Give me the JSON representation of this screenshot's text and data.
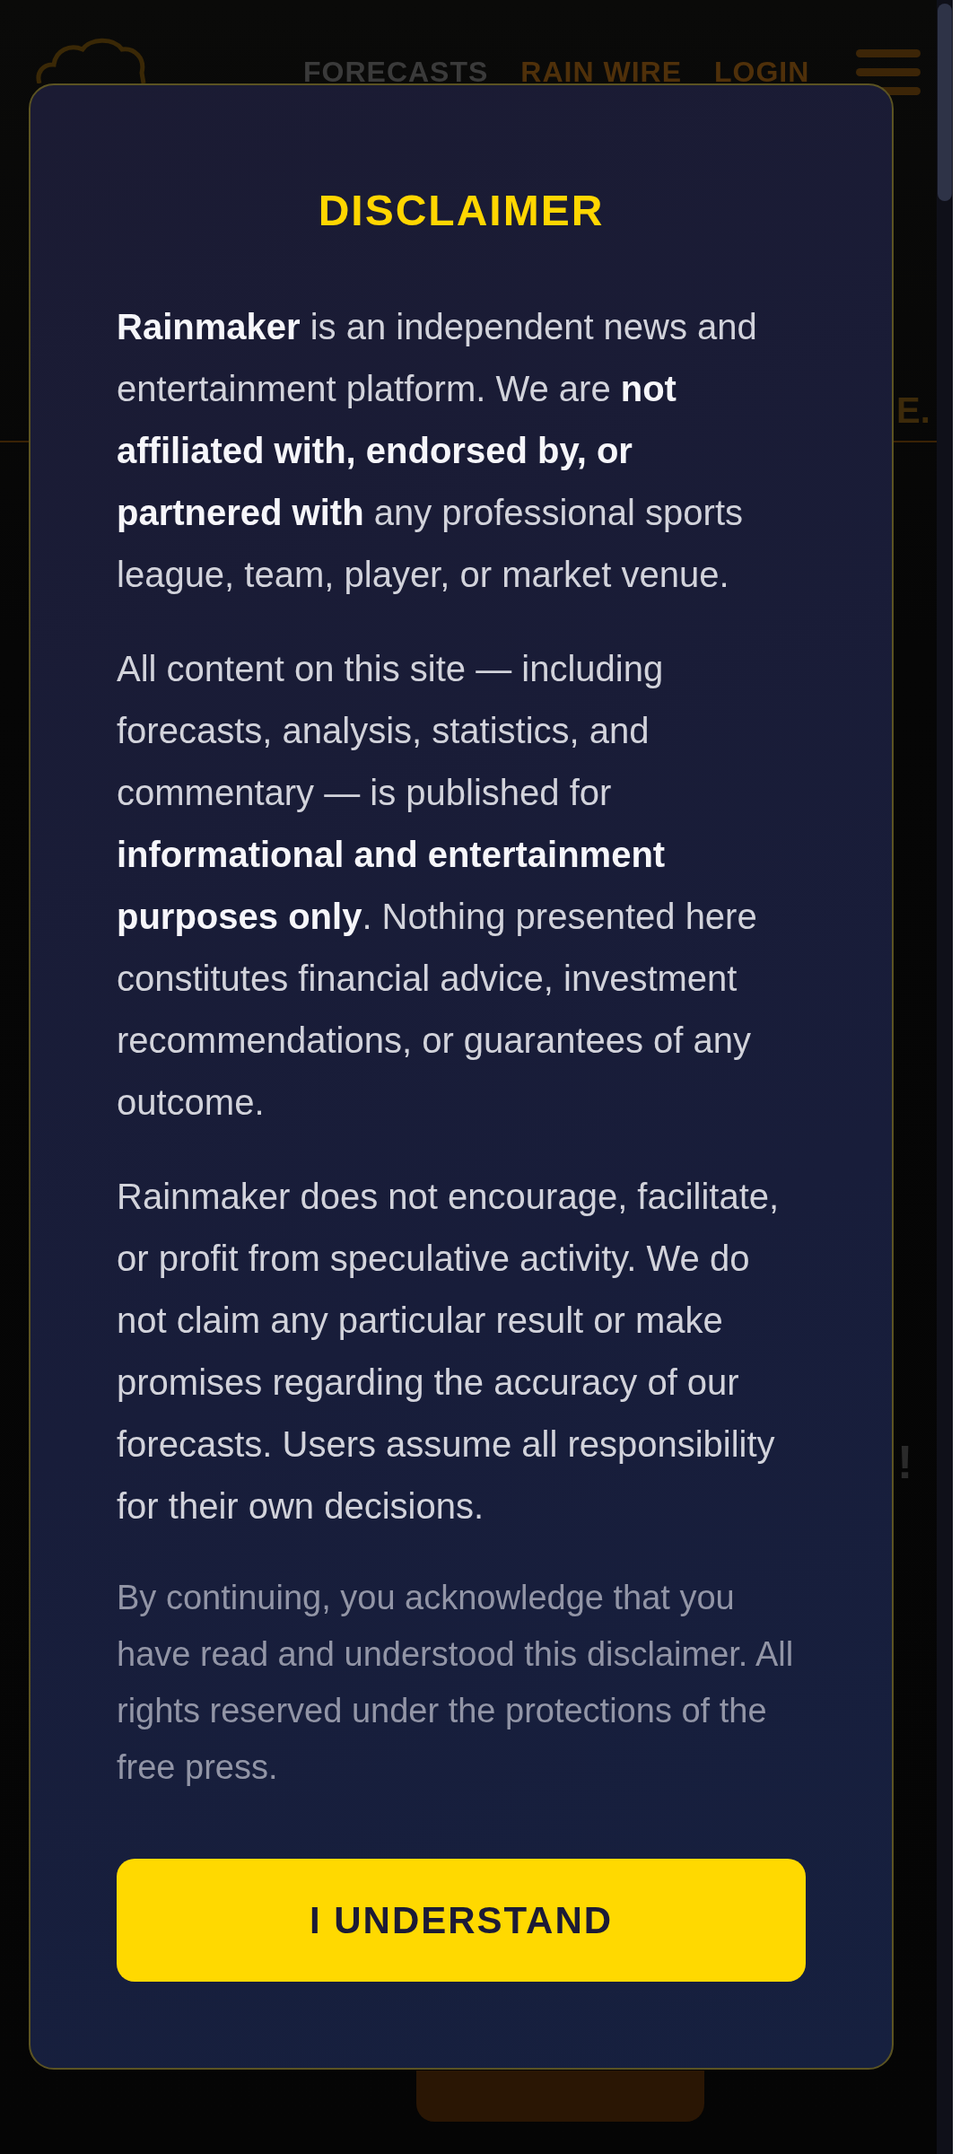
{
  "header": {
    "nav": [
      {
        "label": "FORECASTS",
        "color": "#3a3a3a"
      },
      {
        "label": "RAIN WIRE",
        "color": "#4f300a"
      },
      {
        "label": "LOGIN",
        "color": "#4f300a"
      }
    ]
  },
  "background": {
    "fragments": [
      "E.",
      "!"
    ]
  },
  "dialog": {
    "title": "DISCLAIMER",
    "paragraphs": [
      {
        "kind": "body",
        "text": "**Rainmaker** is an independent news and entertainment platform. We are **not affiliated with, endorsed by, or partnered with** any professional sports league, team, player, or market venue."
      },
      {
        "kind": "body",
        "text": "All content on this site — including forecasts, analysis, statistics, and commentary — is published for **informational and entertainment purposes only**. Nothing presented here constitutes financial advice, investment recommendations, or guarantees of any outcome."
      },
      {
        "kind": "body",
        "text": "Rainmaker does not encourage, facilitate, or profit from speculative activity. We do not claim any particular result or make promises regarding the accuracy of our forecasts. Users assume all responsibility for their own decisions."
      },
      {
        "kind": "note",
        "text": "By continuing, you acknowledge that you have read and understood this disclaimer. All rights reserved under the protections of the free press."
      }
    ],
    "button": "I UNDERSTAND"
  }
}
